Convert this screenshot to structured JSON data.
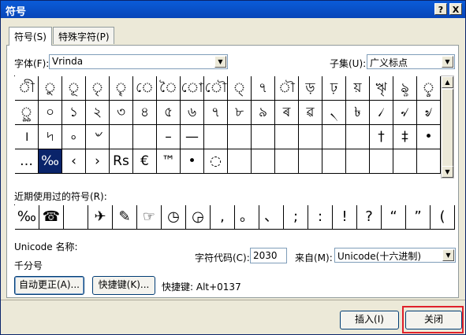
{
  "window": {
    "title": "符号",
    "help_btn": "?",
    "close_btn": "X"
  },
  "tabs": [
    {
      "label": "符号(S)"
    },
    {
      "label": "特殊字符(P)"
    }
  ],
  "font": {
    "label": "字体(F):",
    "value": "Vrinda"
  },
  "subset": {
    "label": "子集(U):",
    "value": "广义标点"
  },
  "grid_rows": [
    [
      "ী",
      "ু",
      "ূ",
      "ৃ",
      "ৄ",
      "ে",
      "ৈ",
      "ো",
      "ৌ",
      "্",
      "৭",
      "ৗ",
      "ড়",
      "ঢ়",
      "য়",
      "ৠ",
      "ৡ",
      "ৢ"
    ],
    [
      "ৣ",
      "০",
      "১",
      "২",
      "৩",
      "৪",
      "৫",
      "৬",
      "৭",
      "৮",
      "৯",
      "ৰ",
      "ৱ",
      "৲",
      "৳",
      "৴",
      "৵",
      "৶"
    ],
    [
      "।",
      "৸",
      "৹",
      "৺",
      "",
      "",
      "–",
      "—",
      "",
      "",
      "",
      "",
      "",
      "",
      "",
      "†",
      "‡",
      "•"
    ],
    [
      "…",
      "‰",
      "‹",
      "›",
      "Rs",
      "€",
      "™",
      "•",
      "◌",
      "",
      "",
      "",
      "",
      "",
      "",
      "",
      "",
      ""
    ]
  ],
  "selected_cell": "‰",
  "recent": {
    "label": "近期使用过的符号(R):",
    "symbols": [
      "‰",
      "☎",
      "",
      "✈",
      "✎",
      "☞",
      "◷",
      "◶",
      ",",
      "。",
      "、",
      ";",
      ":",
      "!",
      "?",
      "“",
      "”",
      "("
    ]
  },
  "unicode": {
    "name_label": "Unicode 名称:",
    "name_value": "千分号"
  },
  "char_code": {
    "label": "字符代码(C):",
    "value": "2030"
  },
  "from": {
    "label": "来自(M):",
    "value": "Unicode(十六进制)"
  },
  "buttons": {
    "autocorrect": "自动更正(A)...",
    "shortcut_key": "快捷键(K)...",
    "shortcut_text": "快捷键: Alt+0137",
    "insert": "插入(I)",
    "close": "关闭"
  }
}
